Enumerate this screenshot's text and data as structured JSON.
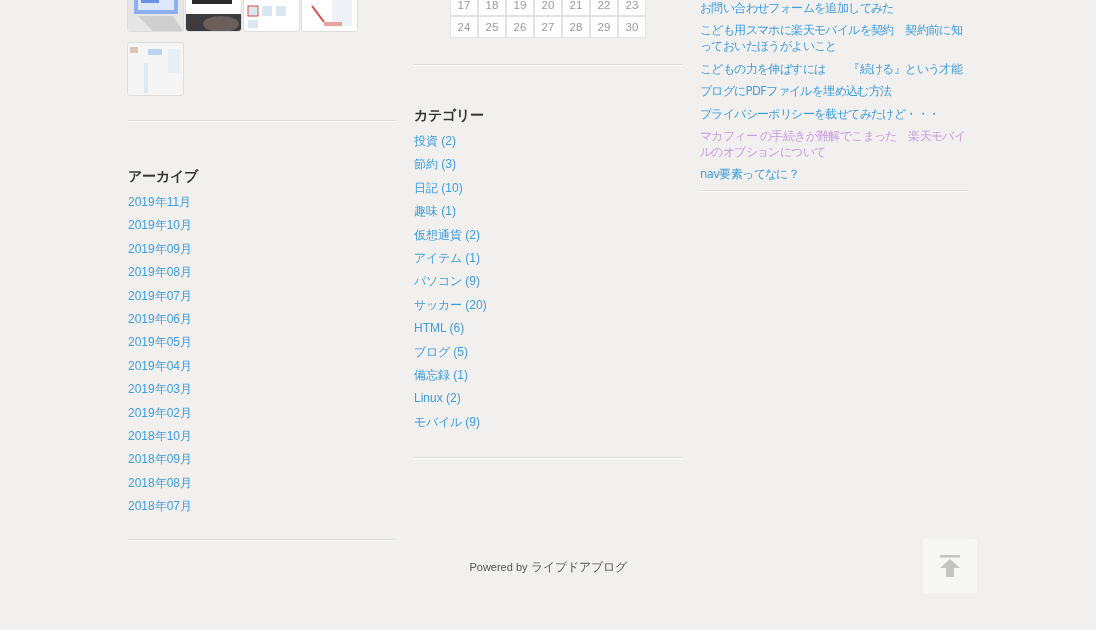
{
  "calendar": {
    "weeks": [
      [
        "17",
        "18",
        "19",
        "20",
        "21",
        "22",
        "23"
      ],
      [
        "24",
        "25",
        "26",
        "27",
        "28",
        "29",
        "30"
      ]
    ]
  },
  "archive": {
    "title": "アーカイブ",
    "items": [
      "2019年11月",
      "2019年10月",
      "2019年09月",
      "2019年08月",
      "2019年07月",
      "2019年06月",
      "2019年05月",
      "2019年04月",
      "2019年03月",
      "2019年02月",
      "2018年10月",
      "2018年09月",
      "2018年08月",
      "2018年07月"
    ]
  },
  "categories": {
    "title": "カテゴリー",
    "items": [
      "投資 (2)",
      "節約 (3)",
      "日記 (10)",
      "趣味 (1)",
      "仮想通貨 (2)",
      "アイテム (1)",
      "パソコン (9)",
      "サッカー (20)",
      "HTML (6)",
      "ブログ (5)",
      "備忘録 (1)",
      "Linux (2)",
      "モバイル (9)"
    ]
  },
  "recent_posts": [
    {
      "title": "お問い合わせフォームを追加してみた",
      "visited": false
    },
    {
      "title": "こども用スマホに楽天モバイルを契約　契約前に知っておいたほうがよいこと",
      "visited": false
    },
    {
      "title": "こどもの力を伸ばすには　　『続ける』という才能",
      "visited": false
    },
    {
      "title": "ブログにPDFファイルを埋め込む方法",
      "visited": false
    },
    {
      "title": "プライバシーポリシーを載せてみたけど・・・",
      "visited": false
    },
    {
      "title": "マカフィー の手続きが難解でこまった　楽天モバイルのオプションについて",
      "visited": true
    },
    {
      "title": "nav要素ってなに？",
      "visited": false
    }
  ],
  "footer": {
    "label": "Powered by",
    "link": "ライブドアブログ"
  }
}
